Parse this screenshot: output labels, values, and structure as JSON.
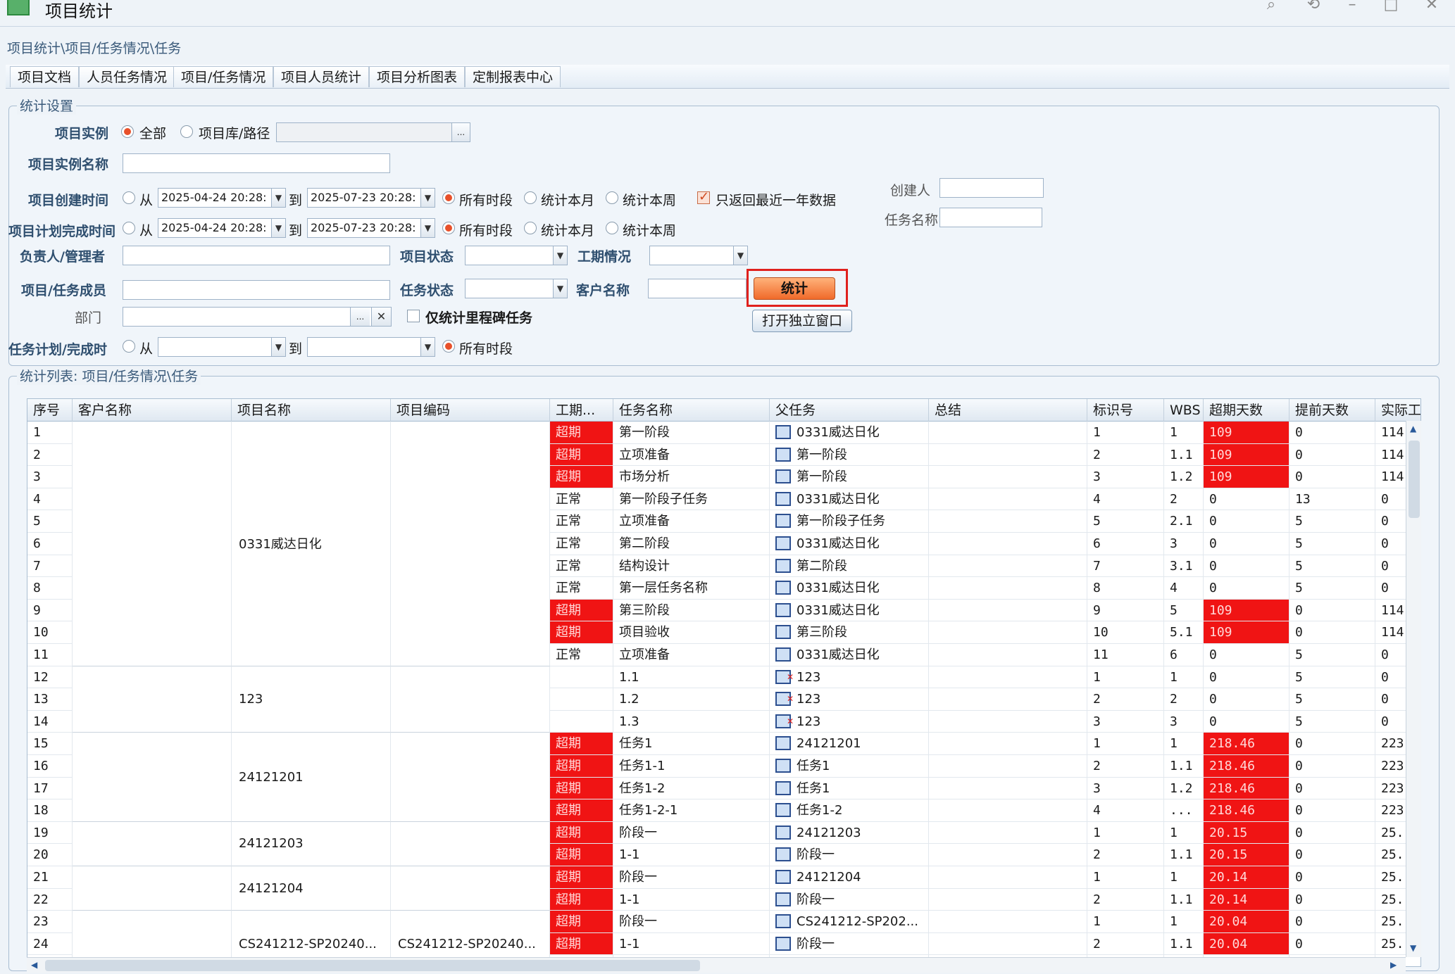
{
  "window": {
    "title": "项目统计",
    "controls": [
      "search-icon",
      "pin-icon",
      "minimize-icon",
      "maximize-icon",
      "close-icon"
    ]
  },
  "breadcrumb": "项目统计\\项目/任务情况\\任务",
  "tabs": [
    "项目文档",
    "人员任务情况",
    "项目/任务情况",
    "项目人员统计",
    "项目分析图表",
    "定制报表中心"
  ],
  "settings": {
    "legend": "统计设置",
    "project_instance": {
      "label": "项目实例",
      "opt_all": "全部",
      "opt_lib": "项目库/路径",
      "selected": "全部",
      "browse": "..."
    },
    "instance_name": {
      "label": "项目实例名称",
      "value": ""
    },
    "create_time": {
      "label": "项目创建时间",
      "from": "从",
      "from_value": "2025-04-24 20:28:",
      "to": "到",
      "to_value": "2025-07-23 20:28:",
      "opt_all": "所有时段",
      "opt_month": "统计本月",
      "opt_week": "统计本周",
      "selected": "所有时段"
    },
    "recent_only": {
      "label": "只返回最近一年数据",
      "checked": true
    },
    "creator": {
      "label": "创建人",
      "value": ""
    },
    "task_name": {
      "label": "任务名称",
      "value": ""
    },
    "plan_finish_time": {
      "label": "项目计划完成时间",
      "from": "从",
      "from_value": "2025-04-24 20:28:",
      "to": "到",
      "to_value": "2025-07-23 20:28:",
      "opt_all": "所有时段",
      "opt_month": "统计本月",
      "opt_week": "统计本周",
      "selected": "所有时段"
    },
    "owner": {
      "label": "负责人/管理者",
      "value": ""
    },
    "project_status": {
      "label": "项目状态",
      "value": ""
    },
    "schedule_status": {
      "label": "工期情况",
      "value": ""
    },
    "member": {
      "label": "项目/任务成员",
      "value": ""
    },
    "task_status": {
      "label": "任务状态",
      "value": ""
    },
    "customer": {
      "label": "客户名称",
      "value": ""
    },
    "department": {
      "label": "部门",
      "value": "",
      "browse": "...",
      "clear": "✕"
    },
    "milestone_only": {
      "label": "仅统计里程碑任务",
      "checked": false
    },
    "task_time": {
      "label": "任务计划/完成时",
      "from": "从",
      "to": "到",
      "opt_all": "所有时段",
      "selected": "所有时段"
    },
    "stat_button": "统计",
    "open_window_button": "打开独立窗口"
  },
  "list": {
    "legend": "统计列表: 项目/任务情况\\任务",
    "columns": [
      "序号",
      "客户名称",
      "项目名称",
      "项目编码",
      "工期...",
      "任务名称",
      "父任务",
      "总结",
      "标识号",
      "WBS",
      "超期天数",
      "提前天数",
      "实际工"
    ],
    "groups": [
      {
        "project": "0331威达日化",
        "code": "",
        "start": 0,
        "count": 11
      },
      {
        "project": "123",
        "code": "",
        "start": 11,
        "count": 3
      },
      {
        "project": "24121201",
        "code": "",
        "start": 14,
        "count": 4
      },
      {
        "project": "24121203",
        "code": "",
        "start": 18,
        "count": 2
      },
      {
        "project": "24121204",
        "code": "",
        "start": 20,
        "count": 2
      },
      {
        "project": "CS241212-SP20240...",
        "code": "CS241212-SP20240...",
        "start": 22,
        "count": 3
      }
    ],
    "rows": [
      {
        "no": "1",
        "status": "超期",
        "task": "第一阶段",
        "parent": "0331威达日化",
        "id": "1",
        "wbs": "1",
        "overdue": "109",
        "early": "0",
        "actual": "114",
        "icon": "task"
      },
      {
        "no": "2",
        "status": "超期",
        "task": "立项准备",
        "parent": "第一阶段",
        "id": "2",
        "wbs": "1.1",
        "overdue": "109",
        "early": "0",
        "actual": "114",
        "icon": "task"
      },
      {
        "no": "3",
        "status": "超期",
        "task": "市场分析",
        "parent": "第一阶段",
        "id": "3",
        "wbs": "1.2",
        "overdue": "109",
        "early": "0",
        "actual": "114",
        "icon": "task"
      },
      {
        "no": "4",
        "status": "正常",
        "task": "第一阶段子任务",
        "parent": "0331威达日化",
        "id": "4",
        "wbs": "2",
        "overdue": "0",
        "early": "13",
        "actual": "0",
        "icon": "task"
      },
      {
        "no": "5",
        "status": "正常",
        "task": "立项准备",
        "parent": "第一阶段子任务",
        "id": "5",
        "wbs": "2.1",
        "overdue": "0",
        "early": "5",
        "actual": "0",
        "icon": "task"
      },
      {
        "no": "6",
        "status": "正常",
        "task": "第二阶段",
        "parent": "0331威达日化",
        "id": "6",
        "wbs": "3",
        "overdue": "0",
        "early": "5",
        "actual": "0",
        "icon": "task"
      },
      {
        "no": "7",
        "status": "正常",
        "task": "结构设计",
        "parent": "第二阶段",
        "id": "7",
        "wbs": "3.1",
        "overdue": "0",
        "early": "5",
        "actual": "0",
        "icon": "task"
      },
      {
        "no": "8",
        "status": "正常",
        "task": "第一层任务名称",
        "parent": "0331威达日化",
        "id": "8",
        "wbs": "4",
        "overdue": "0",
        "early": "5",
        "actual": "0",
        "icon": "task"
      },
      {
        "no": "9",
        "status": "超期",
        "task": "第三阶段",
        "parent": "0331威达日化",
        "id": "9",
        "wbs": "5",
        "overdue": "109",
        "early": "0",
        "actual": "114",
        "icon": "task"
      },
      {
        "no": "10",
        "status": "超期",
        "task": "项目验收",
        "parent": "第三阶段",
        "id": "10",
        "wbs": "5.1",
        "overdue": "109",
        "early": "0",
        "actual": "114",
        "icon": "task"
      },
      {
        "no": "11",
        "status": "正常",
        "task": "立项准备",
        "parent": "0331威达日化",
        "id": "11",
        "wbs": "6",
        "overdue": "0",
        "early": "5",
        "actual": "0",
        "icon": "task"
      },
      {
        "no": "12",
        "status": "",
        "task": "1.1",
        "parent": "123",
        "id": "1",
        "wbs": "1",
        "overdue": "0",
        "early": "5",
        "actual": "0",
        "icon": "task-x"
      },
      {
        "no": "13",
        "status": "",
        "task": "1.2",
        "parent": "123",
        "id": "2",
        "wbs": "2",
        "overdue": "0",
        "early": "5",
        "actual": "0",
        "icon": "task-x"
      },
      {
        "no": "14",
        "status": "",
        "task": "1.3",
        "parent": "123",
        "id": "3",
        "wbs": "3",
        "overdue": "0",
        "early": "5",
        "actual": "0",
        "icon": "task-x"
      },
      {
        "no": "15",
        "status": "超期",
        "task": "任务1",
        "parent": "24121201",
        "id": "1",
        "wbs": "1",
        "overdue": "218.46",
        "early": "0",
        "actual": "223",
        "icon": "task"
      },
      {
        "no": "16",
        "status": "超期",
        "task": "任务1-1",
        "parent": "任务1",
        "id": "2",
        "wbs": "1.1",
        "overdue": "218.46",
        "early": "0",
        "actual": "223",
        "icon": "task"
      },
      {
        "no": "17",
        "status": "超期",
        "task": "任务1-2",
        "parent": "任务1",
        "id": "3",
        "wbs": "1.2",
        "overdue": "218.46",
        "early": "0",
        "actual": "223",
        "icon": "task"
      },
      {
        "no": "18",
        "status": "超期",
        "task": "任务1-2-1",
        "parent": "任务1-2",
        "id": "4",
        "wbs": "...",
        "overdue": "218.46",
        "early": "0",
        "actual": "223",
        "icon": "task"
      },
      {
        "no": "19",
        "status": "超期",
        "task": "阶段一",
        "parent": "24121203",
        "id": "1",
        "wbs": "1",
        "overdue": "20.15",
        "early": "0",
        "actual": "25.",
        "icon": "task"
      },
      {
        "no": "20",
        "status": "超期",
        "task": "1-1",
        "parent": "阶段一",
        "id": "2",
        "wbs": "1.1",
        "overdue": "20.15",
        "early": "0",
        "actual": "25.",
        "icon": "task"
      },
      {
        "no": "21",
        "status": "超期",
        "task": "阶段一",
        "parent": "24121204",
        "id": "1",
        "wbs": "1",
        "overdue": "20.14",
        "early": "0",
        "actual": "25.",
        "icon": "task"
      },
      {
        "no": "22",
        "status": "超期",
        "task": "1-1",
        "parent": "阶段一",
        "id": "2",
        "wbs": "1.1",
        "overdue": "20.14",
        "early": "0",
        "actual": "25.",
        "icon": "task"
      },
      {
        "no": "23",
        "status": "超期",
        "task": "阶段一",
        "parent": "CS241212-SP202...",
        "id": "1",
        "wbs": "1",
        "overdue": "20.04",
        "early": "0",
        "actual": "25.",
        "icon": "task"
      },
      {
        "no": "24",
        "status": "超期",
        "task": "1-1",
        "parent": "阶段一",
        "id": "2",
        "wbs": "1.1",
        "overdue": "20.04",
        "early": "0",
        "actual": "25.",
        "icon": "task"
      },
      {
        "no": "",
        "status": "",
        "task": "",
        "parent": "",
        "id": "",
        "wbs": "",
        "overdue": "",
        "early": "",
        "actual": "",
        "icon": "task"
      }
    ]
  },
  "colors": {
    "overdue": "#f01414",
    "accent": "#e8502a",
    "highlight": "#e0211d"
  }
}
